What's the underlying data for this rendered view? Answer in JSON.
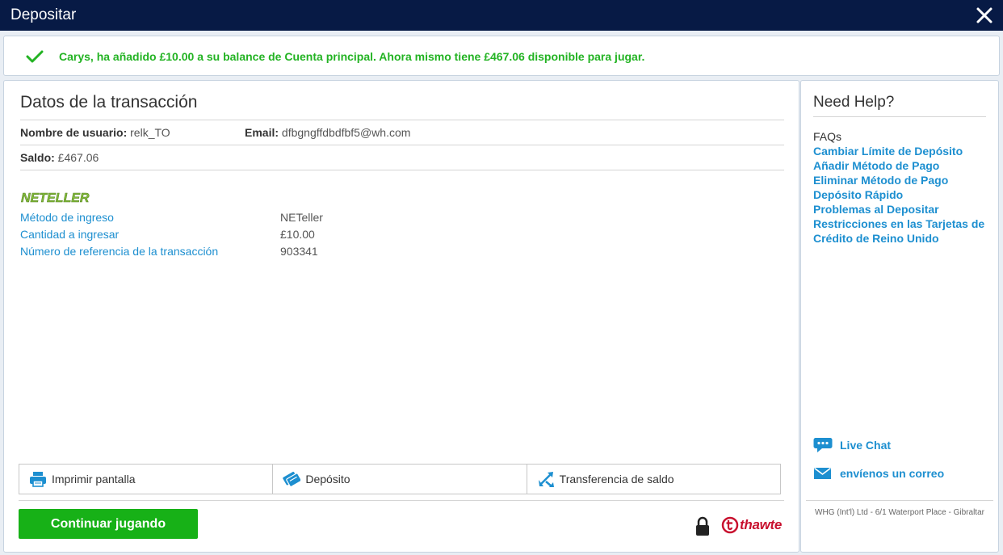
{
  "window": {
    "title": "Depositar"
  },
  "banner": {
    "message": "Carys, ha añadido £10.00 a su balance de Cuenta principal. Ahora mismo tiene £467.06 disponible para jugar."
  },
  "transaction": {
    "heading": "Datos de la transacción",
    "username_label": "Nombre de usuario:",
    "username_value": "relk_TO",
    "email_label": "Email:",
    "email_value": "dfbgngffdbdfbf5@wh.com",
    "balance_label": "Saldo:",
    "balance_value": "£467.06",
    "provider_logo": "NETELLER",
    "details": [
      {
        "label": "Método de ingreso",
        "value": "NETeller"
      },
      {
        "label": "Cantidad a ingresar",
        "value": "£10.00"
      },
      {
        "label": "Número de referencia de la transacción",
        "value": "903341"
      }
    ]
  },
  "actions": {
    "print": "Imprimir pantalla",
    "deposit": "Depósito",
    "transfer": "Transferencia de saldo",
    "continue": "Continuar jugando"
  },
  "security": {
    "thawte": "thawte"
  },
  "help": {
    "title": "Need Help?",
    "faqs_label": "FAQs",
    "links": [
      "Cambiar Límite de Depósito",
      "Añadir Método de Pago",
      "Eliminar Método de Pago",
      "Depósito Rápido",
      "Problemas al Depositar",
      "Restricciones en las Tarjetas de Crédito de Reino Unido"
    ],
    "live_chat": "Live Chat",
    "email_us": "envíenos un correo",
    "footer": "WHG (Int'l) Ltd - 6/1 Waterport Place - Gibraltar"
  },
  "colors": {
    "titlebar": "#071a45",
    "success": "#23b323",
    "link": "#1d8fd0",
    "button": "#17b117",
    "thawte": "#c8102e",
    "neteller": "#83ba3b"
  },
  "icons": [
    "close-icon",
    "checkmark-icon",
    "printer-icon",
    "deposit-icon",
    "transfer-icon",
    "lock-icon",
    "chat-icon",
    "envelope-icon"
  ]
}
